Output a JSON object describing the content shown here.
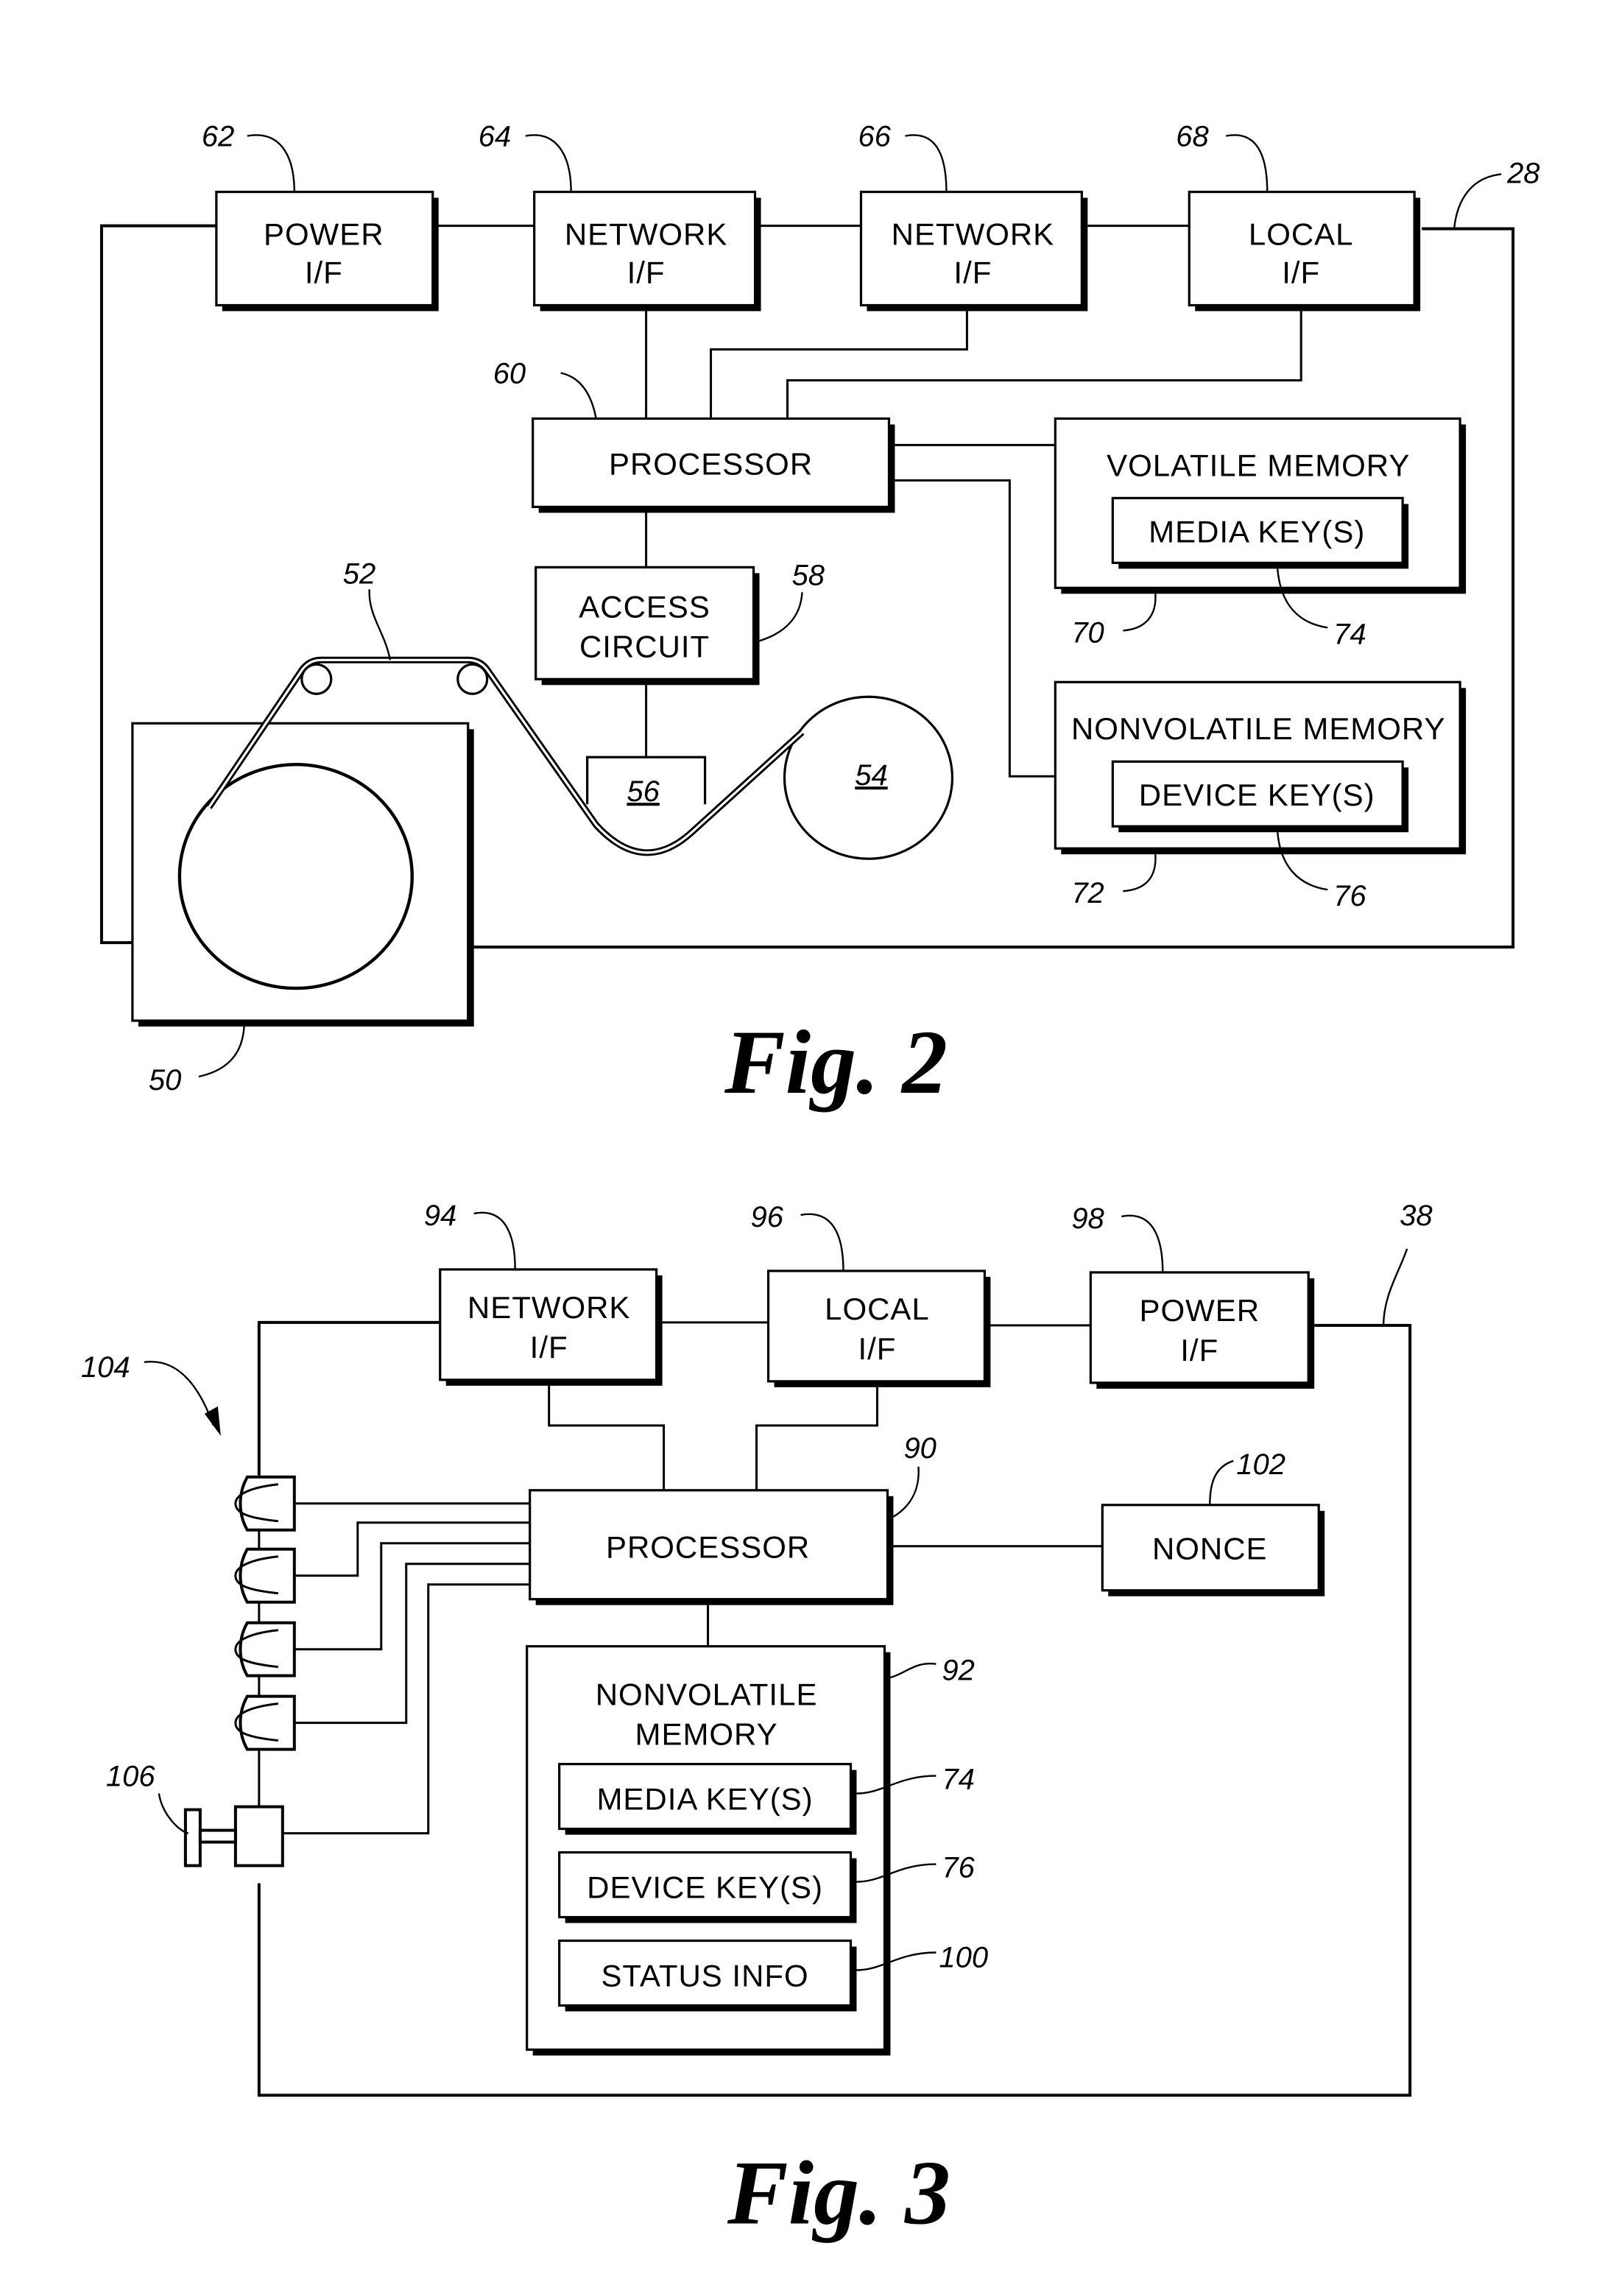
{
  "figures": {
    "fig2": {
      "caption": "Fig. 2",
      "device_ref": "28",
      "blocks": {
        "power_if": {
          "line1": "POWER",
          "line2": "I/F",
          "ref": "62"
        },
        "network_if_a": {
          "line1": "NETWORK",
          "line2": "I/F",
          "ref": "64"
        },
        "network_if_b": {
          "line1": "NETWORK",
          "line2": "I/F",
          "ref": "66"
        },
        "local_if": {
          "line1": "LOCAL",
          "line2": "I/F",
          "ref": "68"
        },
        "processor": {
          "label": "PROCESSOR",
          "ref": "60"
        },
        "volatile_memory": {
          "label": "VOLATILE MEMORY",
          "ref": "70"
        },
        "media_keys": {
          "label": "MEDIA KEY(S)",
          "ref": "74"
        },
        "nonvolatile_memory": {
          "label": "NONVOLATILE MEMORY",
          "ref": "72"
        },
        "device_keys": {
          "label": "DEVICE KEY(S)",
          "ref": "76"
        },
        "access_circuit": {
          "line1": "ACCESS",
          "line2": "CIRCUIT",
          "ref": "58"
        },
        "head": {
          "ref": "56"
        },
        "take_up_reel": {
          "ref": "54"
        },
        "tape": {
          "ref": "52"
        },
        "cartridge": {
          "ref": "50"
        }
      }
    },
    "fig3": {
      "caption": "Fig. 3",
      "device_ref": "38",
      "blocks": {
        "network_if": {
          "line1": "NETWORK",
          "line2": "I/F",
          "ref": "94"
        },
        "local_if": {
          "line1": "LOCAL",
          "line2": "I/F",
          "ref": "96"
        },
        "power_if": {
          "line1": "POWER",
          "line2": "I/F",
          "ref": "98"
        },
        "processor": {
          "label": "PROCESSOR",
          "ref": "90"
        },
        "nonce": {
          "label": "NONCE",
          "ref": "102"
        },
        "nonvolatile_memory": {
          "line1": "NONVOLATILE",
          "line2": "MEMORY",
          "ref": "92"
        },
        "media_keys": {
          "label": "MEDIA KEY(S)",
          "ref": "74"
        },
        "device_keys": {
          "label": "DEVICE KEY(S)",
          "ref": "76"
        },
        "status_info": {
          "label": "STATUS INFO",
          "ref": "100"
        },
        "leds": {
          "ref": "104",
          "count": 4
        },
        "switch": {
          "ref": "106"
        }
      }
    }
  }
}
